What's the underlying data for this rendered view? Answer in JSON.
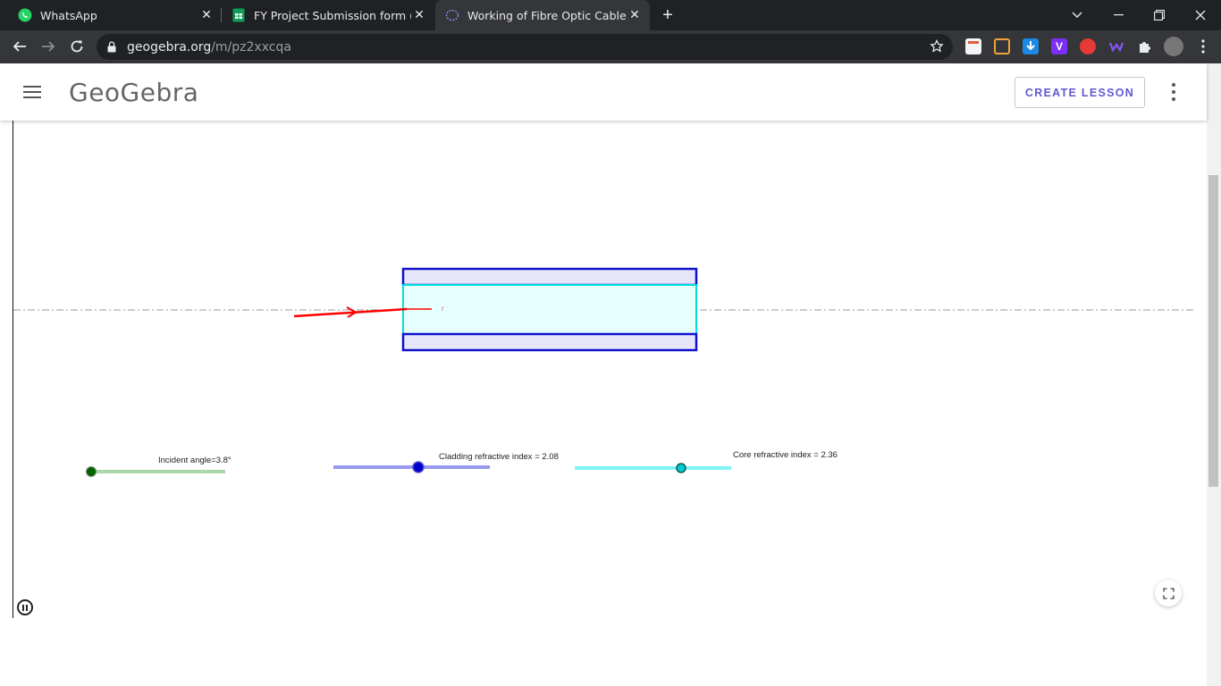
{
  "browser": {
    "tabs": [
      {
        "title": "WhatsApp",
        "icon": "whatsapp-icon"
      },
      {
        "title": "FY Project Submission form (Resp",
        "icon": "google-sheets-icon"
      },
      {
        "title": "Working of Fibre Optic Cables – (",
        "icon": "geogebra-icon",
        "active": true
      }
    ],
    "url_domain": "geogebra.org",
    "url_path": "/m/pz2xxcqa"
  },
  "header": {
    "logo_text": "GeoGebra",
    "create_lesson_label": "CREATE LESSON"
  },
  "applet": {
    "ray_label": "r",
    "sliders": {
      "incident": {
        "label": "Incident angle=3.8°",
        "color": "#006400",
        "value_fraction": 0.0
      },
      "cladding": {
        "label": "Cladding refractive index = 2.08",
        "color": "#0000cc",
        "value_fraction": 0.54
      },
      "core": {
        "label": "Core refractive index = 2.36",
        "color": "#00cccc",
        "value_fraction": 0.68
      }
    }
  },
  "colors": {
    "cladding_fill": "#e6e6fa",
    "core_fill": "#e6ffff",
    "ray": "#ff0000",
    "accent": "#6557d2"
  }
}
